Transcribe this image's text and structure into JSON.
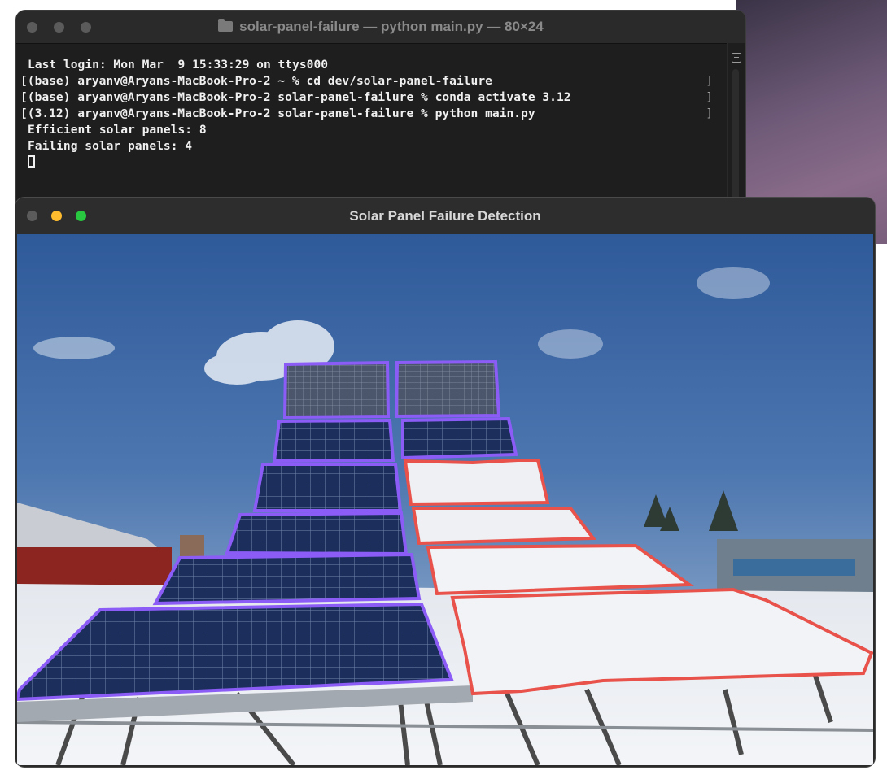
{
  "terminal": {
    "title": "solar-panel-failure — python main.py — 80×24",
    "lines": [
      "Last login: Mon Mar  9 15:33:29 on ttys000",
      "[(base) aryanv@Aryans-MacBook-Pro-2 ~ % cd dev/solar-panel-failure",
      "[(base) aryanv@Aryans-MacBook-Pro-2 solar-panel-failure % conda activate 3.12",
      "[(3.12) aryanv@Aryans-MacBook-Pro-2 solar-panel-failure % python main.py",
      "Efficient solar panels: 8",
      "Failing solar panels: 4"
    ],
    "right_bracket": "]"
  },
  "viewer": {
    "title": "Solar Panel Failure Detection"
  },
  "colors": {
    "efficient_outline": "#8b5cf6",
    "failing_outline": "#e8524a",
    "close_light": "#5b5b5b",
    "minimize_light": "#febc2e",
    "maximize_light": "#28c840"
  }
}
